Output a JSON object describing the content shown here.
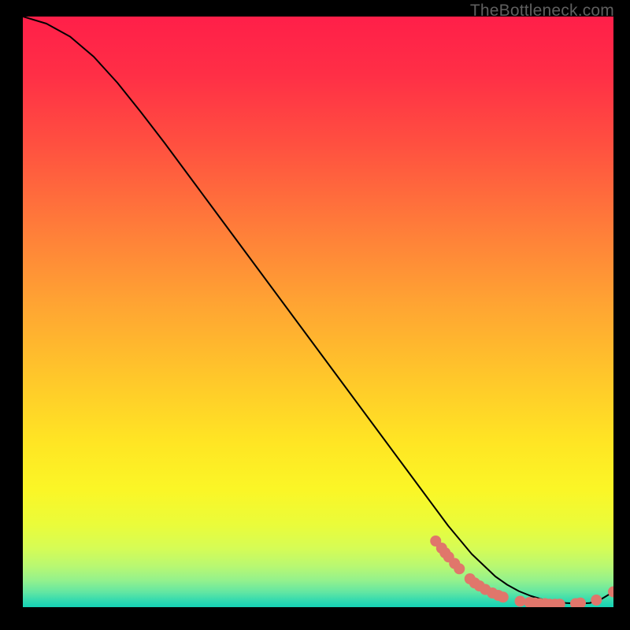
{
  "watermark": "TheBottleneck.com",
  "chart_data": {
    "type": "line",
    "title": "",
    "xlabel": "",
    "ylabel": "",
    "xlim": [
      0,
      100
    ],
    "ylim": [
      0,
      100
    ],
    "grid": false,
    "legend": false,
    "series": [
      {
        "name": "curve",
        "x": [
          0,
          4,
          8,
          12,
          16,
          20,
          24,
          28,
          32,
          36,
          40,
          44,
          48,
          52,
          56,
          60,
          64,
          68,
          72,
          76,
          80,
          82,
          84,
          86,
          88,
          90,
          92,
          94,
          96,
          98,
          100
        ],
        "y": [
          100.0,
          98.8,
          96.6,
          93.2,
          88.8,
          83.8,
          78.6,
          73.2,
          67.8,
          62.4,
          57.0,
          51.6,
          46.2,
          40.8,
          35.4,
          30.0,
          24.6,
          19.2,
          13.8,
          9.0,
          5.2,
          3.8,
          2.7,
          1.9,
          1.3,
          0.9,
          0.7,
          0.6,
          0.7,
          1.4,
          2.6
        ]
      }
    ],
    "markers": {
      "name": "highlight-points",
      "color": "#e0766b",
      "x": [
        69.9,
        70.9,
        71.5,
        72.1,
        73.1,
        73.9,
        75.7,
        76.5,
        77.3,
        78.3,
        79.5,
        80.5,
        81.3,
        84.2,
        85.8,
        86.7,
        87.5,
        88.4,
        89.2,
        90.1,
        90.9,
        93.6,
        94.4,
        97.1,
        100.0
      ],
      "y": [
        11.2,
        10.0,
        9.2,
        8.5,
        7.4,
        6.5,
        4.8,
        4.1,
        3.6,
        3.0,
        2.4,
        2.0,
        1.7,
        1.0,
        0.8,
        0.7,
        0.6,
        0.6,
        0.5,
        0.5,
        0.5,
        0.6,
        0.7,
        1.2,
        2.6
      ]
    }
  }
}
